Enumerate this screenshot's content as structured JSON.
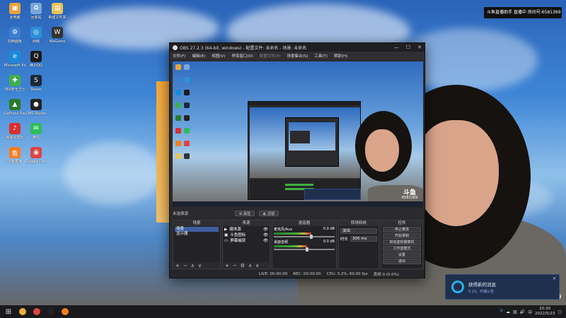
{
  "desktop": {
    "icons": [
      {
        "label": "此电脑",
        "color": "#e8a33a",
        "glyph": "▣"
      },
      {
        "label": "回收站",
        "color": "#7aa6d8",
        "glyph": "♻"
      },
      {
        "label": "控制面板",
        "color": "#3c7fd0",
        "glyph": "⚙"
      },
      {
        "label": "网络",
        "color": "#2e8fd8",
        "glyph": "◎"
      },
      {
        "label": "Microsoft Edge",
        "color": "#1a8bd8",
        "glyph": "e"
      },
      {
        "label": "腾讯QQ",
        "color": "#1a1a1a",
        "glyph": "Q"
      },
      {
        "label": "360安全卫士",
        "color": "#3fae4b",
        "glyph": "✚"
      },
      {
        "label": "Steam",
        "color": "#1b2838",
        "glyph": "S"
      },
      {
        "label": "GeForce Experience",
        "color": "#2b7a2b",
        "glyph": "▲"
      },
      {
        "label": "OBS Studio",
        "color": "#222",
        "glyph": "●"
      },
      {
        "label": "网易云音乐",
        "color": "#d8302e",
        "glyph": "♪"
      },
      {
        "label": "微信",
        "color": "#2ebd59",
        "glyph": "✉"
      },
      {
        "label": "斗鱼直播",
        "color": "#f57d1f",
        "glyph": "鱼"
      },
      {
        "label": "Google Chrome",
        "color": "#d44",
        "glyph": "◉"
      },
      {
        "label": "新建文件夹",
        "color": "#e8c35a",
        "glyph": "▤"
      },
      {
        "label": "WeGame",
        "color": "#333",
        "glyph": "W"
      }
    ]
  },
  "top_notice": "斗鱼直播助手  直播中   房间号:6581369",
  "obs": {
    "title": "OBS 27.2.3 (64-bit, windows) - 配置文件: 未命名 - 场景: 未命名",
    "window_controls": [
      "—",
      "☐",
      "✕"
    ],
    "menu": [
      "文件(F)",
      "编辑(E)",
      "视图(V)",
      "停靠窗口(D)",
      "配置文件(P)",
      "场景集合(S)",
      "工具(T)",
      "帮助(H)"
    ],
    "scene_bar": {
      "label": "未选择源",
      "props": "属性",
      "filters": "滤镜"
    },
    "docks": {
      "scenes": {
        "title": "场景",
        "items": [
          "场景",
          "显示器"
        ]
      },
      "sources": {
        "title": "来源",
        "items": [
          "媒体源",
          "斗鱼图标",
          "屏幕捕获"
        ]
      },
      "mixer": {
        "title": "混音器",
        "tracks": [
          {
            "name": "麦克风/Aux",
            "db": "0.0 dB",
            "level": 0.62
          },
          {
            "name": "桌面音频",
            "db": "0.0 dB",
            "level": 0.55
          }
        ]
      },
      "transitions": {
        "title": "转场特效",
        "type": "淡出",
        "duration_label": "时长",
        "duration": "300 ms"
      },
      "controls": {
        "title": "控件",
        "buttons": [
          "停止推流",
          "开始录制",
          "启动虚拟摄像机",
          "工作室模式",
          "设置",
          "退出"
        ]
      }
    },
    "status": {
      "live": "LIVE: 00:00:00",
      "rec": "REC: 00:00:00",
      "cpu": "CPU: 3.2%, 60.00 fps",
      "drops": "丢帧 0 (0.0%)"
    }
  },
  "toast": {
    "title": "获得新的消息",
    "body": "5.23，开播公告",
    "close": "✕"
  },
  "douyu": {
    "logo": "斗鱼",
    "room_id": "6581369"
  },
  "taskbar": {
    "start": "⊞",
    "apps": [
      {
        "name": "file-explorer",
        "color": "#e8b13a"
      },
      {
        "name": "chrome",
        "color": "#d44"
      },
      {
        "name": "obs",
        "color": "#222"
      },
      {
        "name": "douyu",
        "color": "#f57d1f"
      }
    ],
    "tray": {
      "ime": "中",
      "time": "20:30",
      "date": "2022/5/23"
    }
  },
  "colors": {
    "accent": "#3f5f9e",
    "toast_ring": "#2ab0e8"
  }
}
